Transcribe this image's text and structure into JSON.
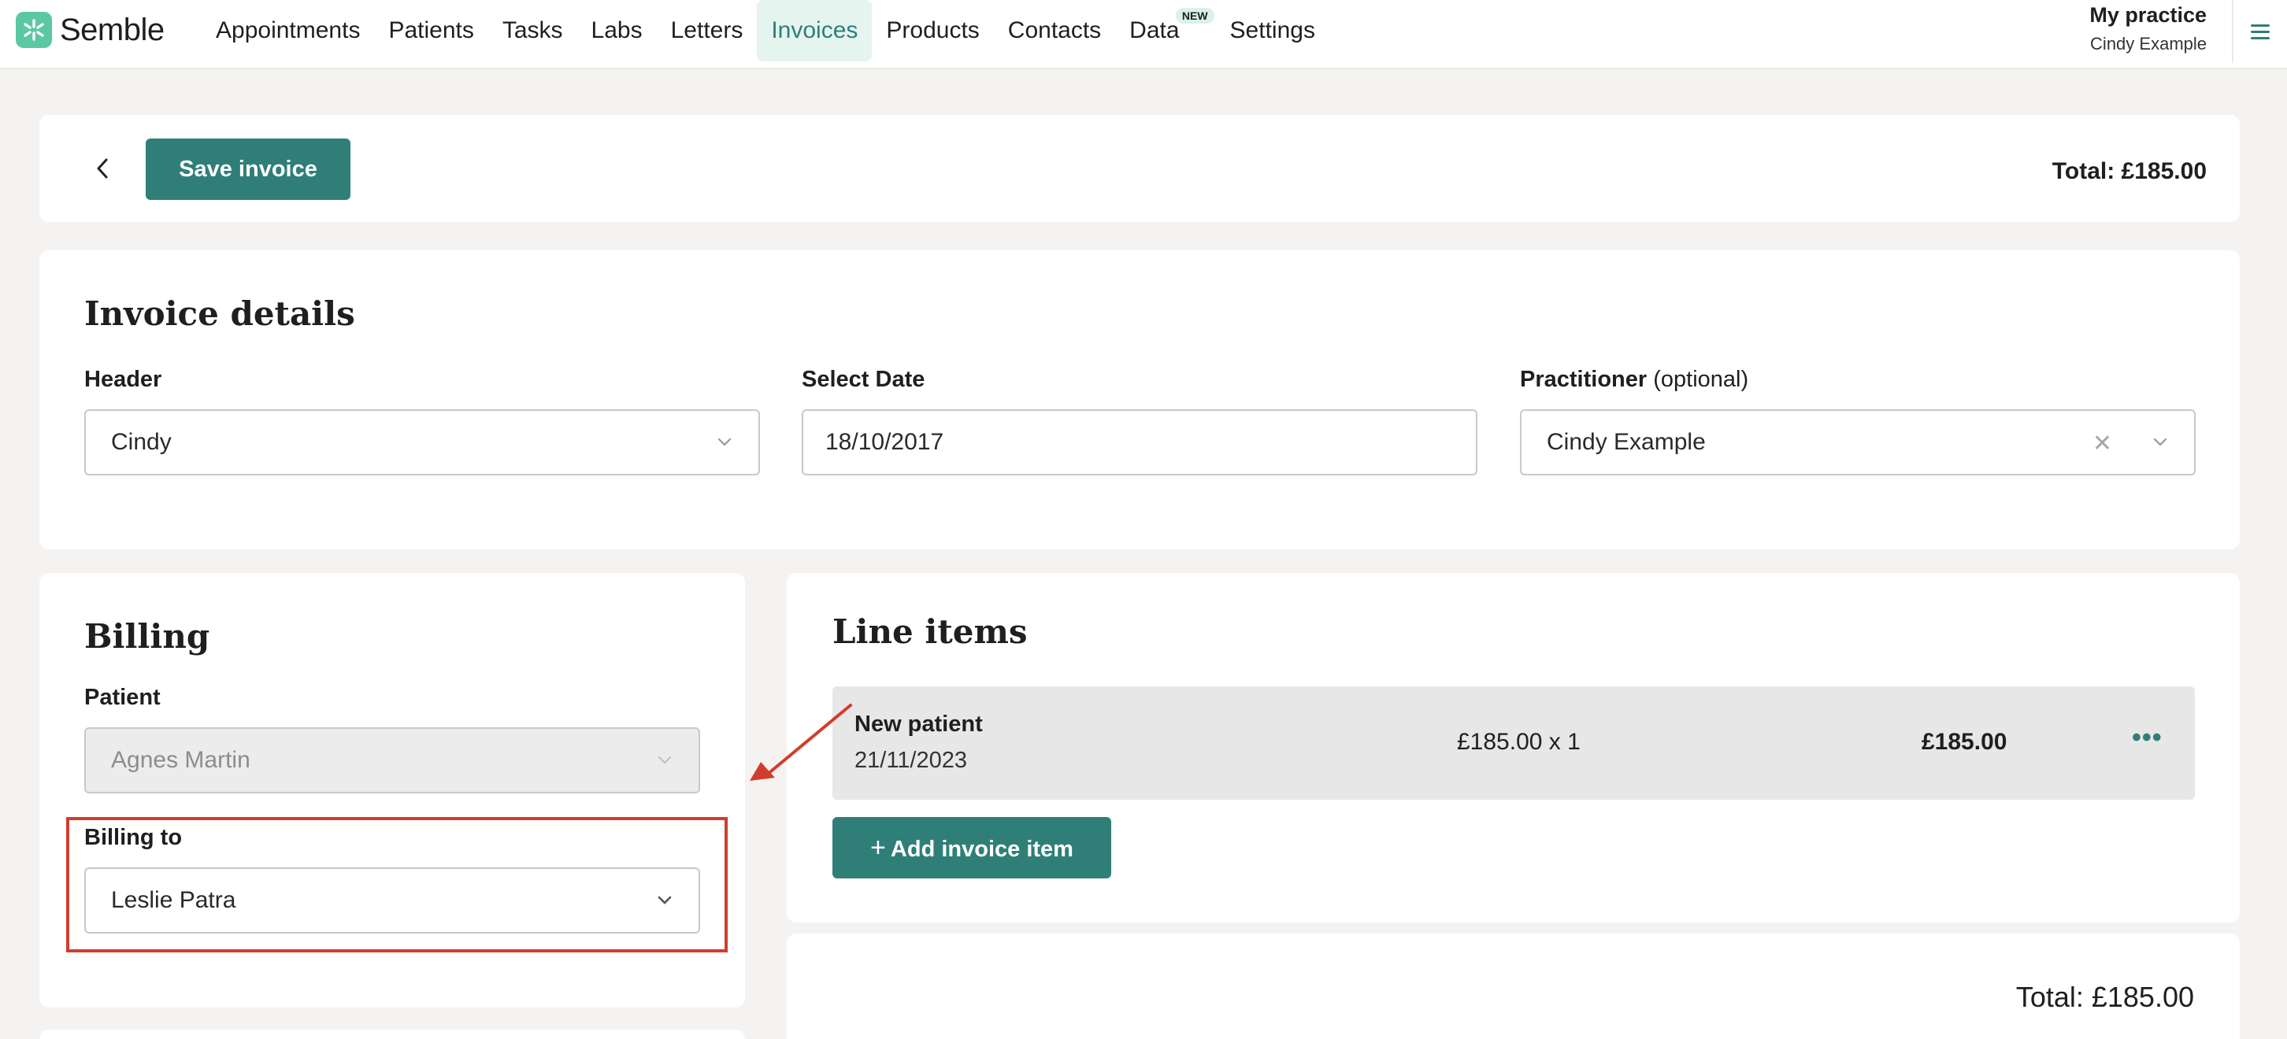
{
  "brand": {
    "name": "Semble",
    "accent": "#2f7f78",
    "logo_color": "#5cc7a3"
  },
  "nav": {
    "items": [
      {
        "label": "Appointments"
      },
      {
        "label": "Patients"
      },
      {
        "label": "Tasks"
      },
      {
        "label": "Labs"
      },
      {
        "label": "Letters"
      },
      {
        "label": "Invoices",
        "active": true
      },
      {
        "label": "Products"
      },
      {
        "label": "Contacts"
      },
      {
        "label": "Data",
        "badge": "NEW"
      },
      {
        "label": "Settings"
      }
    ],
    "practice_name": "My practice",
    "user_name": "Cindy Example",
    "menu_icon": "hamburger-menu-icon"
  },
  "toolbar": {
    "back_icon": "chevron-left-icon",
    "save_label": "Save invoice",
    "total": "Total: £185.00"
  },
  "details": {
    "title": "Invoice details",
    "header": {
      "label": "Header",
      "value": "Cindy"
    },
    "date": {
      "label": "Select Date",
      "value": "18/10/2017"
    },
    "practitioner": {
      "label": "Practitioner",
      "optional": "(optional)",
      "value": "Cindy Example"
    }
  },
  "billing": {
    "title": "Billing",
    "patient": {
      "label": "Patient",
      "value": "Agnes Martin"
    },
    "billing_to": {
      "label": "Billing to",
      "value": "Leslie Patra"
    }
  },
  "line_items": {
    "title": "Line items",
    "rows": [
      {
        "name": "New patient",
        "date": "21/11/2023",
        "qty": "£185.00 x 1",
        "amount": "£185.00"
      }
    ],
    "add_label": "Add invoice item"
  },
  "totals": {
    "total": "Total: £185.00"
  },
  "annotation": {
    "color": "#d13d2c"
  }
}
